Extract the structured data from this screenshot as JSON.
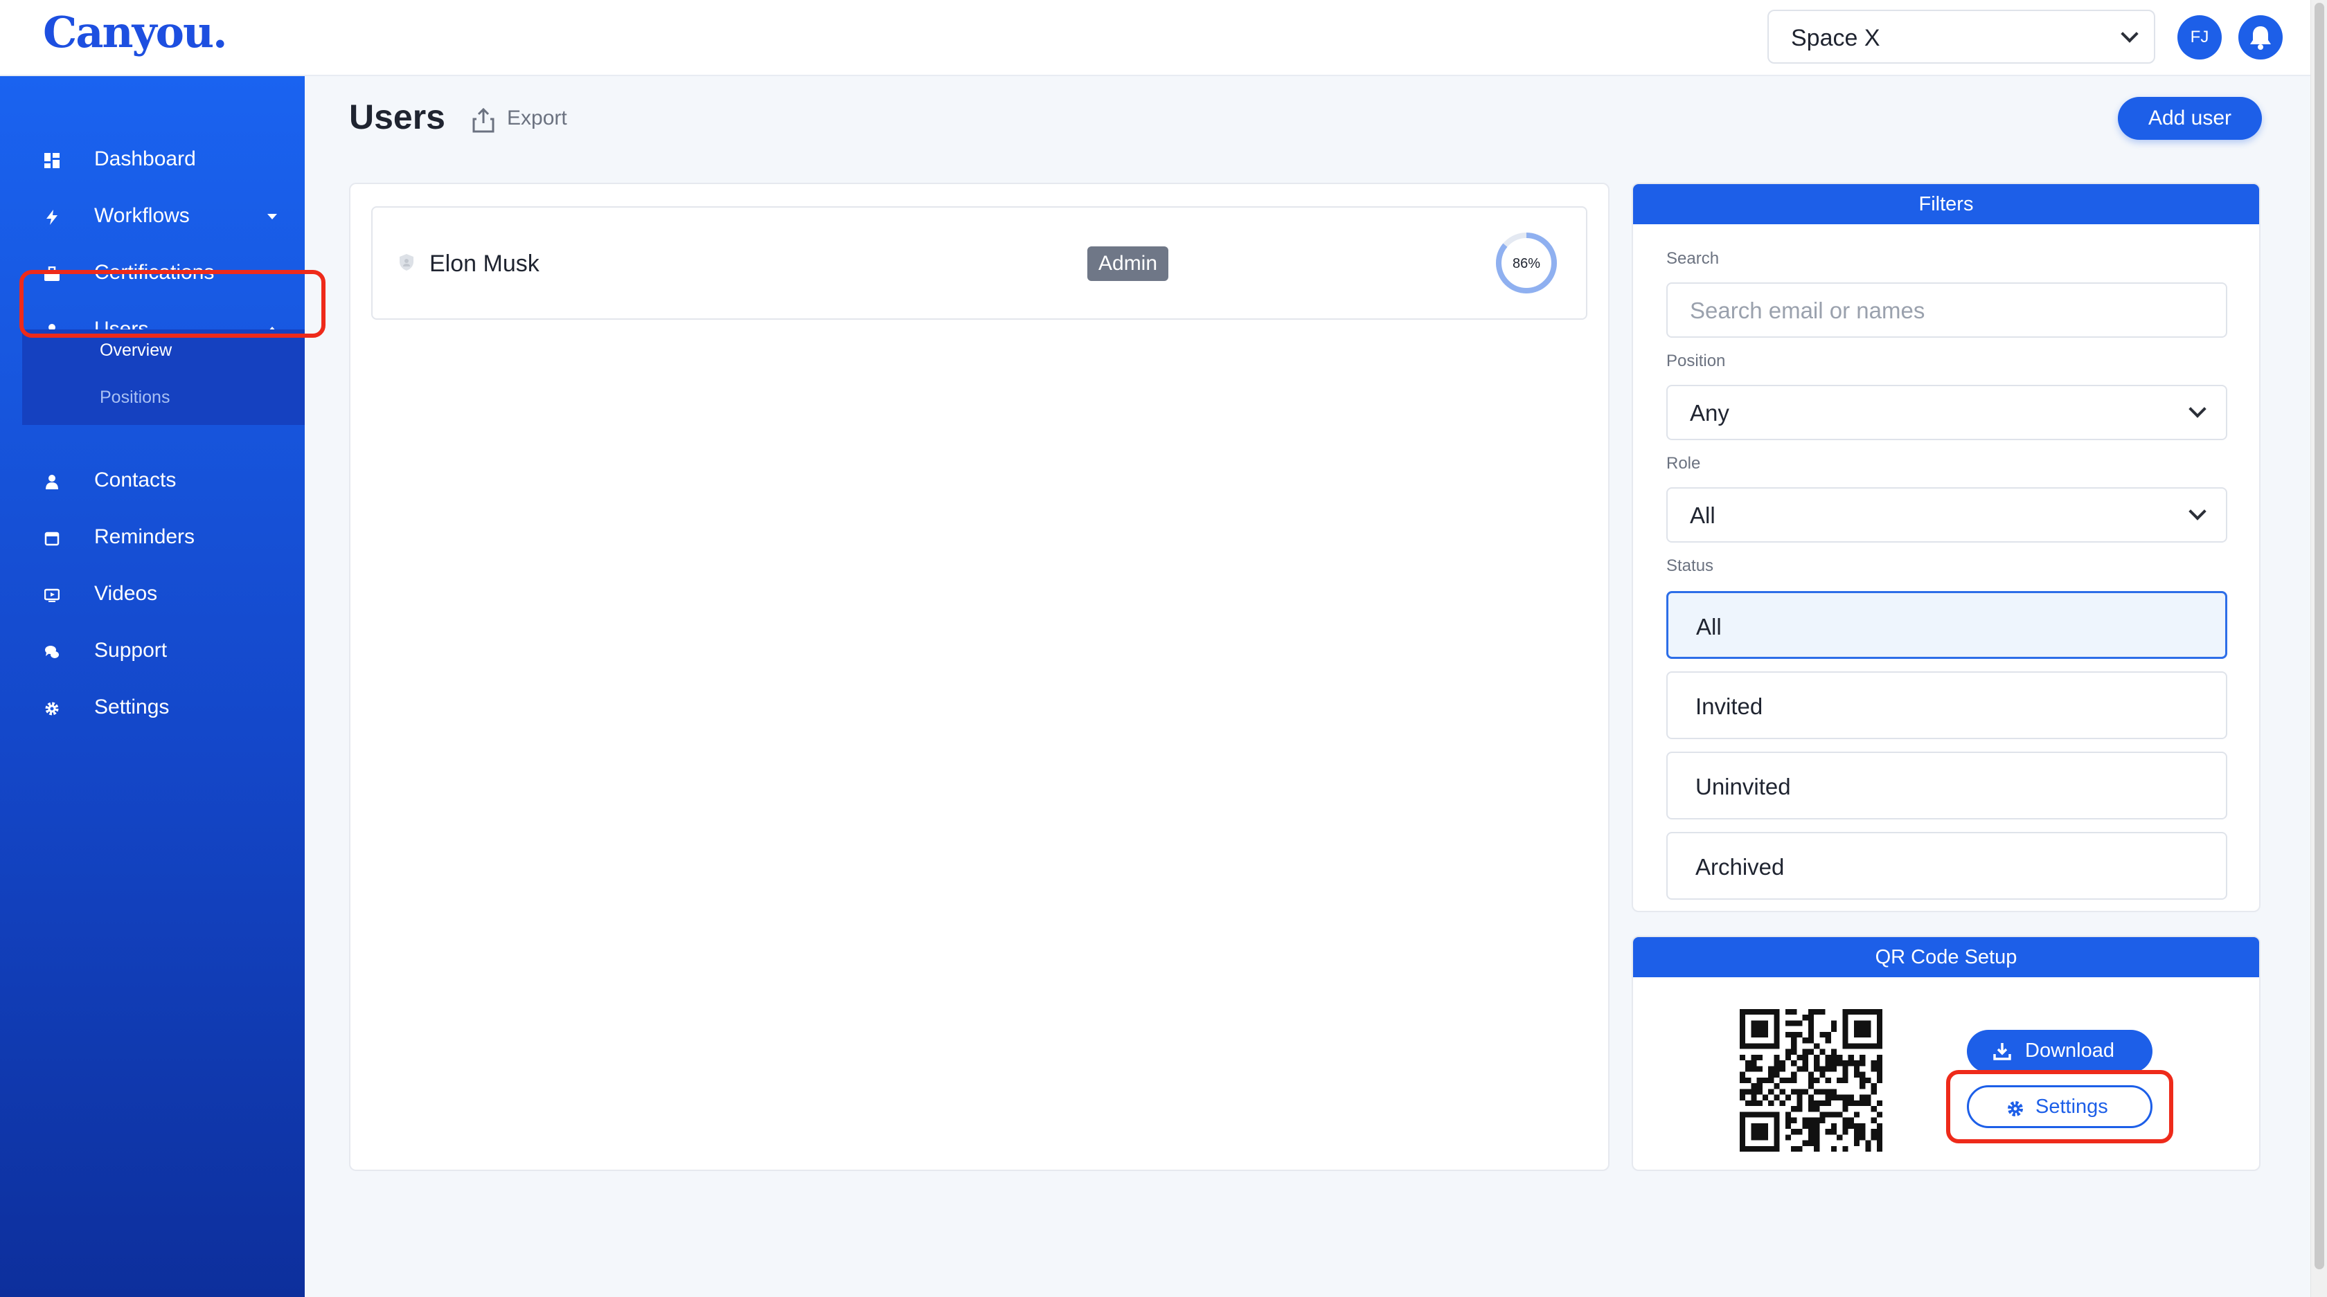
{
  "app": {
    "logo": "Canyou."
  },
  "header": {
    "space": "Space X",
    "avatar_initials": "FJ"
  },
  "sidebar": {
    "items": [
      {
        "label": "Dashboard",
        "icon": "dashboard-icon"
      },
      {
        "label": "Workflows",
        "icon": "lightning-icon",
        "caret": "down"
      },
      {
        "label": "Certifications",
        "icon": "briefcase-icon"
      },
      {
        "label": "Users",
        "icon": "user-icon",
        "caret": "up",
        "active": true
      },
      {
        "label": "Contacts",
        "icon": "user-icon"
      },
      {
        "label": "Reminders",
        "icon": "calendar-icon"
      },
      {
        "label": "Videos",
        "icon": "video-icon"
      },
      {
        "label": "Support",
        "icon": "chat-icon"
      },
      {
        "label": "Settings",
        "icon": "gear-icon"
      }
    ],
    "subitems": [
      {
        "label": "Overview",
        "active": true
      },
      {
        "label": "Positions",
        "active": false
      }
    ]
  },
  "page": {
    "title": "Users",
    "export_label": "Export",
    "add_user_label": "Add user"
  },
  "users": [
    {
      "name": "Elon Musk",
      "role_badge": "Admin",
      "progress_label": "86%",
      "progress": 0.86
    }
  ],
  "filters": {
    "title": "Filters",
    "search_label": "Search",
    "search_placeholder": "Search email or names",
    "position_label": "Position",
    "position_value": "Any",
    "role_label": "Role",
    "role_value": "All",
    "status_label": "Status",
    "status_options": [
      {
        "label": "All",
        "selected": true
      },
      {
        "label": "Invited",
        "selected": false
      },
      {
        "label": "Uninvited",
        "selected": false
      },
      {
        "label": "Archived",
        "selected": false
      }
    ]
  },
  "qr": {
    "title": "QR Code Setup",
    "download_label": "Download",
    "settings_label": "Settings"
  },
  "colors": {
    "primary": "#1d5fe8",
    "highlight": "#ee2a1a",
    "badge": "#6f7787"
  }
}
